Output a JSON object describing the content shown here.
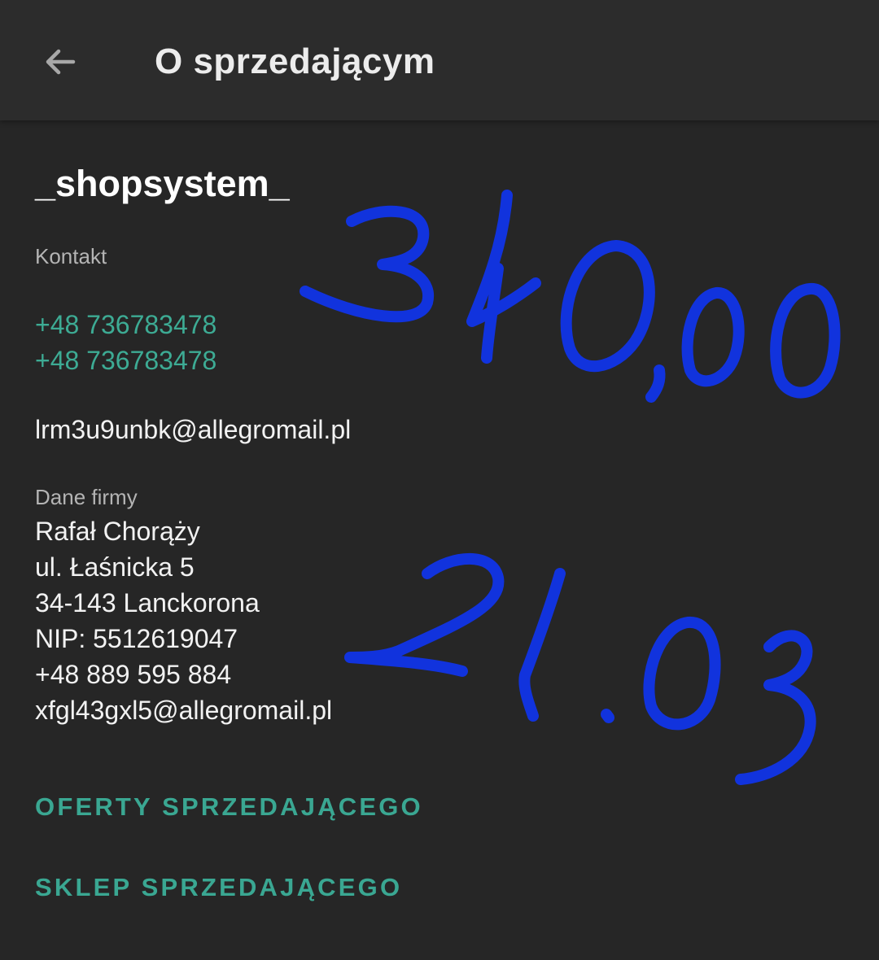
{
  "header": {
    "back_icon": "arrow-left-icon",
    "title": "O sprzedającym"
  },
  "seller": {
    "name": "_shopsystem_"
  },
  "contact": {
    "label": "Kontakt",
    "phones": [
      "+48 736783478",
      "+48 736783478"
    ],
    "email": "lrm3u9unbk@allegromail.pl"
  },
  "company": {
    "label": "Dane firmy",
    "lines": [
      "Rafał Chorąży",
      "ul. Łaśnicka 5",
      "34-143 Lanckorona",
      "NIP: 5512619047",
      "+48 889 595 884",
      "xfgl43gxl5@allegromail.pl"
    ]
  },
  "actions": {
    "offers_label": "OFERTY SPRZEDAJĄCEGO",
    "shop_label": "SKLEP SPRZEDAJĄCEGO"
  },
  "handwritten": {
    "amount": "340,00",
    "date": "21.03",
    "ink_color": "#1133dd"
  },
  "colors": {
    "accent": "#3dab94",
    "background": "#262626",
    "appbar": "#2c2c2c"
  }
}
